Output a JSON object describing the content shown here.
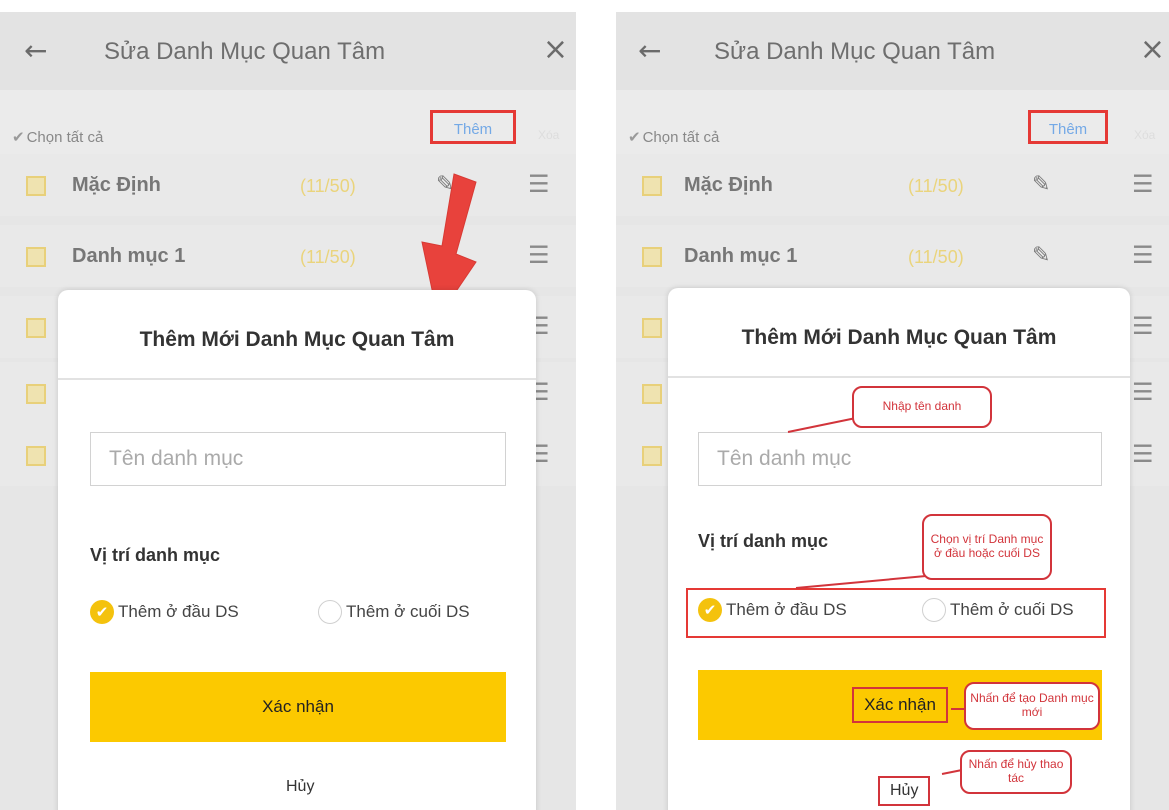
{
  "header": {
    "back_icon": "←",
    "title": "Sửa Danh Mục Quan Tâm",
    "close_icon": "×"
  },
  "toolbar": {
    "select_all_icon": "✔",
    "select_all": "Chọn tất cả",
    "add": "Thêm",
    "delete": "Xóa"
  },
  "rows": [
    {
      "name": "Mặc Định",
      "count": "(11/50)"
    },
    {
      "name": "Danh mục 1",
      "count": "(11/50)"
    }
  ],
  "dialog": {
    "title": "Thêm Mới Danh Mục Quan Tâm",
    "name_placeholder": "Tên danh mục",
    "position_label": "Vị trí danh mục",
    "option_top": "Thêm ở đầu DS",
    "option_bottom": "Thêm ở cuối DS",
    "confirm": "Xác nhận",
    "cancel": "Hủy"
  },
  "callouts": {
    "enter_name": "Nhập tên danh",
    "choose_position": "Chọn vị trí Danh mục ở đầu hoặc cuối DS",
    "press_create": "Nhấn để tạo Danh mục mới",
    "press_cancel": "Nhấn để hủy thao tác"
  },
  "colors": {
    "accent": "#fcc900",
    "highlight": "#e53935",
    "link": "#74a9e6"
  }
}
